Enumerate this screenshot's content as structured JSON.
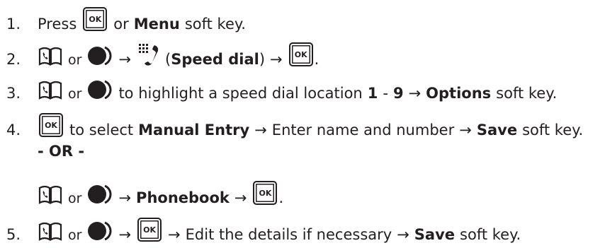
{
  "steps": [
    {
      "number": "1.",
      "press": "Press",
      "or_text": "or",
      "menu": "Menu",
      "softkey": "soft key."
    },
    {
      "number": "2.",
      "or_text": "or",
      "arrow": "→",
      "speed_dial": "Speed dial",
      "paren_open": "(",
      "paren_close": ")",
      "period": "."
    },
    {
      "number": "3.",
      "or_text": "or",
      "text_a": "to highlight a speed dial location",
      "one": "1",
      "dash": "-",
      "nine": "9",
      "arrow": "→",
      "options": "Options",
      "softkey": "soft key."
    },
    {
      "number": "4.",
      "text_a": "to select",
      "manual_entry": "Manual Entry",
      "arrow": "→",
      "text_b": "Enter name and number",
      "save": "Save",
      "softkey": "soft key.",
      "or_divider": "- OR -",
      "or_text": "or",
      "phonebook": "Phonebook",
      "period": "."
    },
    {
      "number": "5.",
      "or_text": "or",
      "arrow": "→",
      "text_b": "Edit the details if necessary",
      "save": "Save",
      "softkey": "soft key."
    }
  ],
  "ok_key_label": "OK",
  "icons": [
    "ok-key-icon",
    "phonebook-key-icon",
    "nav-key-icon",
    "speed-dial-icon"
  ]
}
